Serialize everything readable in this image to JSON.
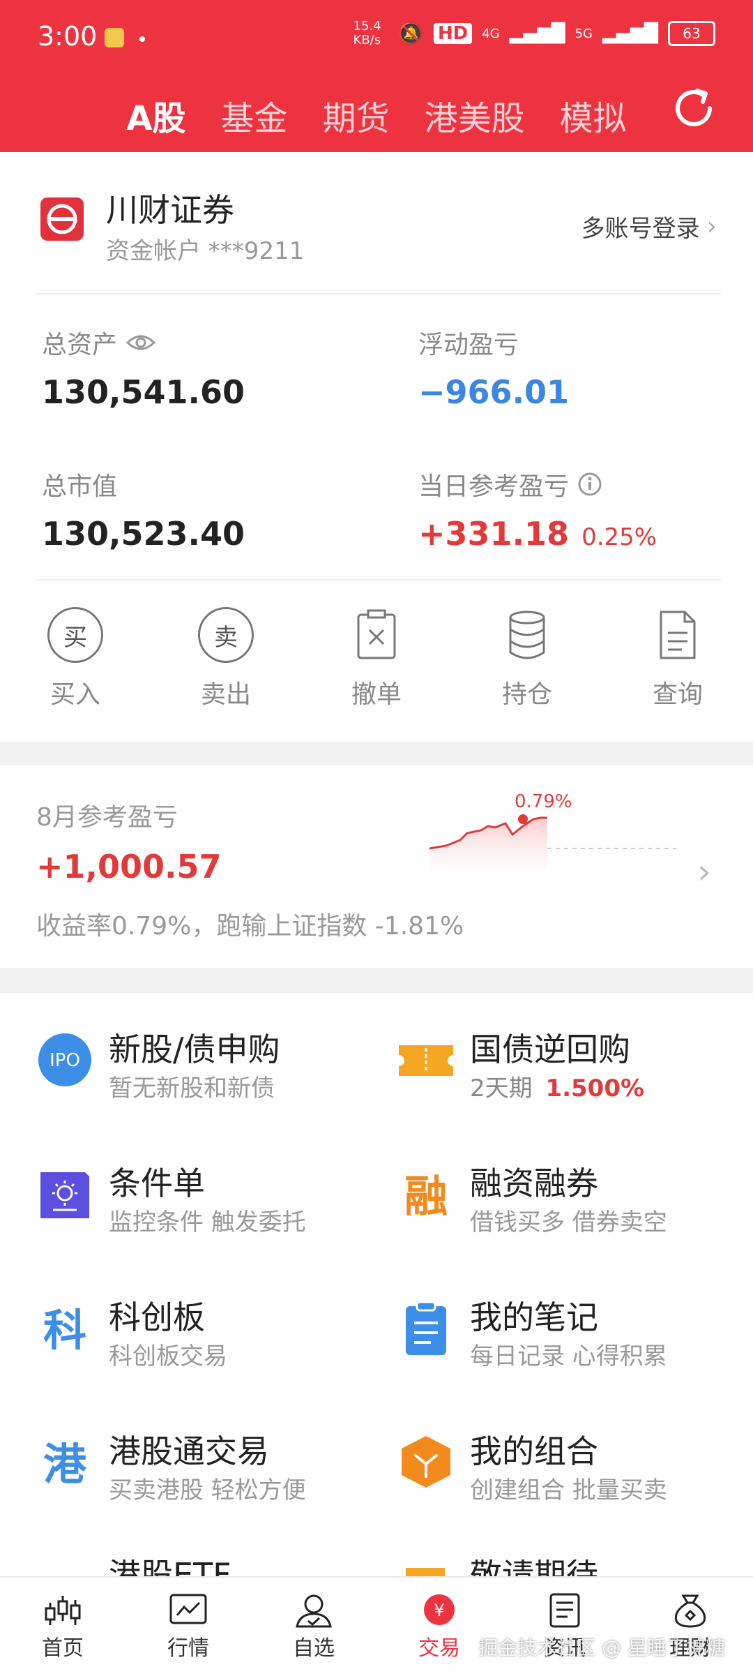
{
  "status": {
    "time": "3:00",
    "net_speed": "15.4 KB/s",
    "hd": "HD",
    "signal1": "4G",
    "signal2": "5G",
    "battery": "63"
  },
  "tabs": [
    {
      "label": "A股",
      "active": true
    },
    {
      "label": "基金",
      "active": false
    },
    {
      "label": "期货",
      "active": false
    },
    {
      "label": "港美股",
      "active": false
    },
    {
      "label": "模拟",
      "active": false
    }
  ],
  "broker": {
    "name": "川财证券",
    "account": "资金帐户 ***9211",
    "multi_login": "多账号登录"
  },
  "assets": {
    "total_label": "总资产",
    "total_value": "130,541.60",
    "float_label": "浮动盈亏",
    "float_value": "−966.01",
    "market_label": "总市值",
    "market_value": "130,523.40",
    "daily_label": "当日参考盈亏",
    "daily_value": "+331.18",
    "daily_pct": "0.25%"
  },
  "actions": [
    {
      "label": "买入",
      "glyph": "买"
    },
    {
      "label": "卖出",
      "glyph": "卖"
    },
    {
      "label": "撤单",
      "icon": "cancel-order-icon"
    },
    {
      "label": "持仓",
      "icon": "database-icon"
    },
    {
      "label": "查询",
      "icon": "document-icon"
    }
  ],
  "monthly": {
    "title": "8月参考盈亏",
    "value": "+1,000.57",
    "desc": "收益率0.79%，跑输上证指数 -1.81%",
    "chart_pct": "0.79%"
  },
  "services": [
    {
      "title": "新股/债申购",
      "sub": "暂无新股和新债",
      "icon": "ipo-icon",
      "icon_text": "IPO",
      "color": "#3c8ee6"
    },
    {
      "title": "国债逆回购",
      "sub_prefix": "2天期",
      "sub_rate": "1.500%",
      "icon": "ticket-icon",
      "color": "#f5a623"
    },
    {
      "title": "条件单",
      "sub": "监控条件 触发委托",
      "icon": "condition-order-icon",
      "color": "#5b4fe0"
    },
    {
      "title": "融资融券",
      "sub": "借钱买多 借券卖空",
      "icon": "margin-icon",
      "icon_text": "融",
      "color": "#f28a1e"
    },
    {
      "title": "科创板",
      "sub": "科创板交易",
      "icon": "star-market-icon",
      "icon_text": "科",
      "color": "#3c8ee6"
    },
    {
      "title": "我的笔记",
      "sub": "每日记录 心得积累",
      "icon": "notes-icon",
      "color": "#3c8ee6"
    },
    {
      "title": "港股通交易",
      "sub": "买卖港股 轻松方便",
      "icon": "hk-connect-icon",
      "icon_text": "港",
      "color": "#3c8ee6"
    },
    {
      "title": "我的组合",
      "sub": "创建组合 批量买卖",
      "icon": "portfolio-icon",
      "color": "#f28a1e"
    },
    {
      "title": "港股ETF",
      "sub": "",
      "icon": "etf-icon",
      "color": "#3c8ee6"
    },
    {
      "title": "敬请期待",
      "sub": "",
      "icon": "coming-soon-icon",
      "color": "#f5a623"
    }
  ],
  "bottom_nav": [
    {
      "label": "首页",
      "active": false
    },
    {
      "label": "行情",
      "active": false
    },
    {
      "label": "自选",
      "active": false
    },
    {
      "label": "交易",
      "active": true
    },
    {
      "label": "资讯",
      "active": false
    },
    {
      "label": "理财",
      "active": false
    }
  ],
  "watermark": "掘金技术社区 @ 星睡了棉糖"
}
